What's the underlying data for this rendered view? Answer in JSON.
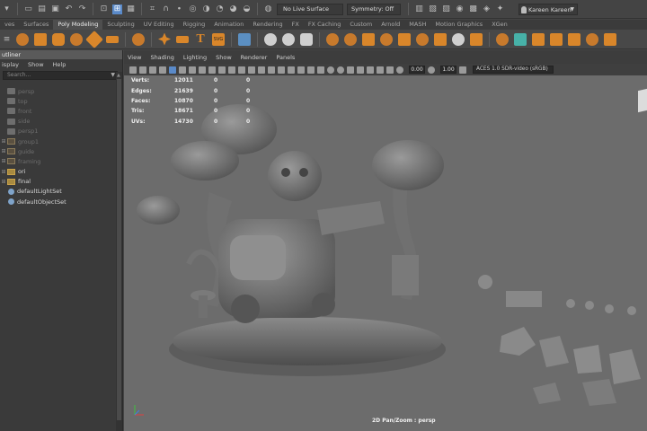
{
  "status_line": {
    "no_live_surface": "No Live Surface",
    "symmetry": "Symmetry: Off",
    "user": "Kareen Kareen"
  },
  "shelf_tabs": [
    {
      "label": "ves"
    },
    {
      "label": "Surfaces"
    },
    {
      "label": "Poly Modeling",
      "active": true
    },
    {
      "label": "Sculpting"
    },
    {
      "label": "UV Editing"
    },
    {
      "label": "Rigging"
    },
    {
      "label": "Animation"
    },
    {
      "label": "Rendering"
    },
    {
      "label": "FX"
    },
    {
      "label": "FX Caching"
    },
    {
      "label": "Custom"
    },
    {
      "label": "Arnold"
    },
    {
      "label": "MASH"
    },
    {
      "label": "Motion Graphics"
    },
    {
      "label": "XGen"
    }
  ],
  "outliner": {
    "title": "utliner",
    "menu": [
      "isplay",
      "Show",
      "Help"
    ],
    "search_placeholder": "Search...",
    "items": [
      {
        "label": "persp",
        "type": "camera",
        "bright": false
      },
      {
        "label": "top",
        "type": "camera",
        "bright": false
      },
      {
        "label": "front",
        "type": "camera",
        "bright": false
      },
      {
        "label": "side",
        "type": "camera",
        "bright": false
      },
      {
        "label": "persp1",
        "type": "camera",
        "bright": false
      },
      {
        "label": "group1",
        "type": "group",
        "bright": false
      },
      {
        "label": "guide",
        "type": "group",
        "bright": false
      },
      {
        "label": "framing",
        "type": "group",
        "bright": false
      },
      {
        "label": "ori",
        "type": "group",
        "bright": true
      },
      {
        "label": "final",
        "type": "group",
        "bright": true
      },
      {
        "label": "defaultLightSet",
        "type": "set",
        "bright": true
      },
      {
        "label": "defaultObjectSet",
        "type": "set",
        "bright": true
      }
    ]
  },
  "viewport": {
    "menu": [
      "View",
      "Shading",
      "Lighting",
      "Show",
      "Renderer",
      "Panels"
    ],
    "exposure": "0.00",
    "gamma": "1.00",
    "color_space": "ACES 1.0 SDR-video (sRGB)",
    "hud": [
      {
        "label": "Verts:",
        "v1": "12011",
        "v2": "0",
        "v3": "0"
      },
      {
        "label": "Edges:",
        "v1": "21639",
        "v2": "0",
        "v3": "0"
      },
      {
        "label": "Faces:",
        "v1": "10870",
        "v2": "0",
        "v3": "0"
      },
      {
        "label": "Tris:",
        "v1": "18671",
        "v2": "0",
        "v3": "0"
      },
      {
        "label": "UVs:",
        "v1": "14730",
        "v2": "0",
        "v3": "0"
      }
    ],
    "camera_label": "2D Pan/Zoom : persp"
  },
  "colors": {
    "accent_orange": "#d9862a",
    "viewport_bg": "#6c6c6c",
    "selection_blue": "#5a8ac9"
  }
}
